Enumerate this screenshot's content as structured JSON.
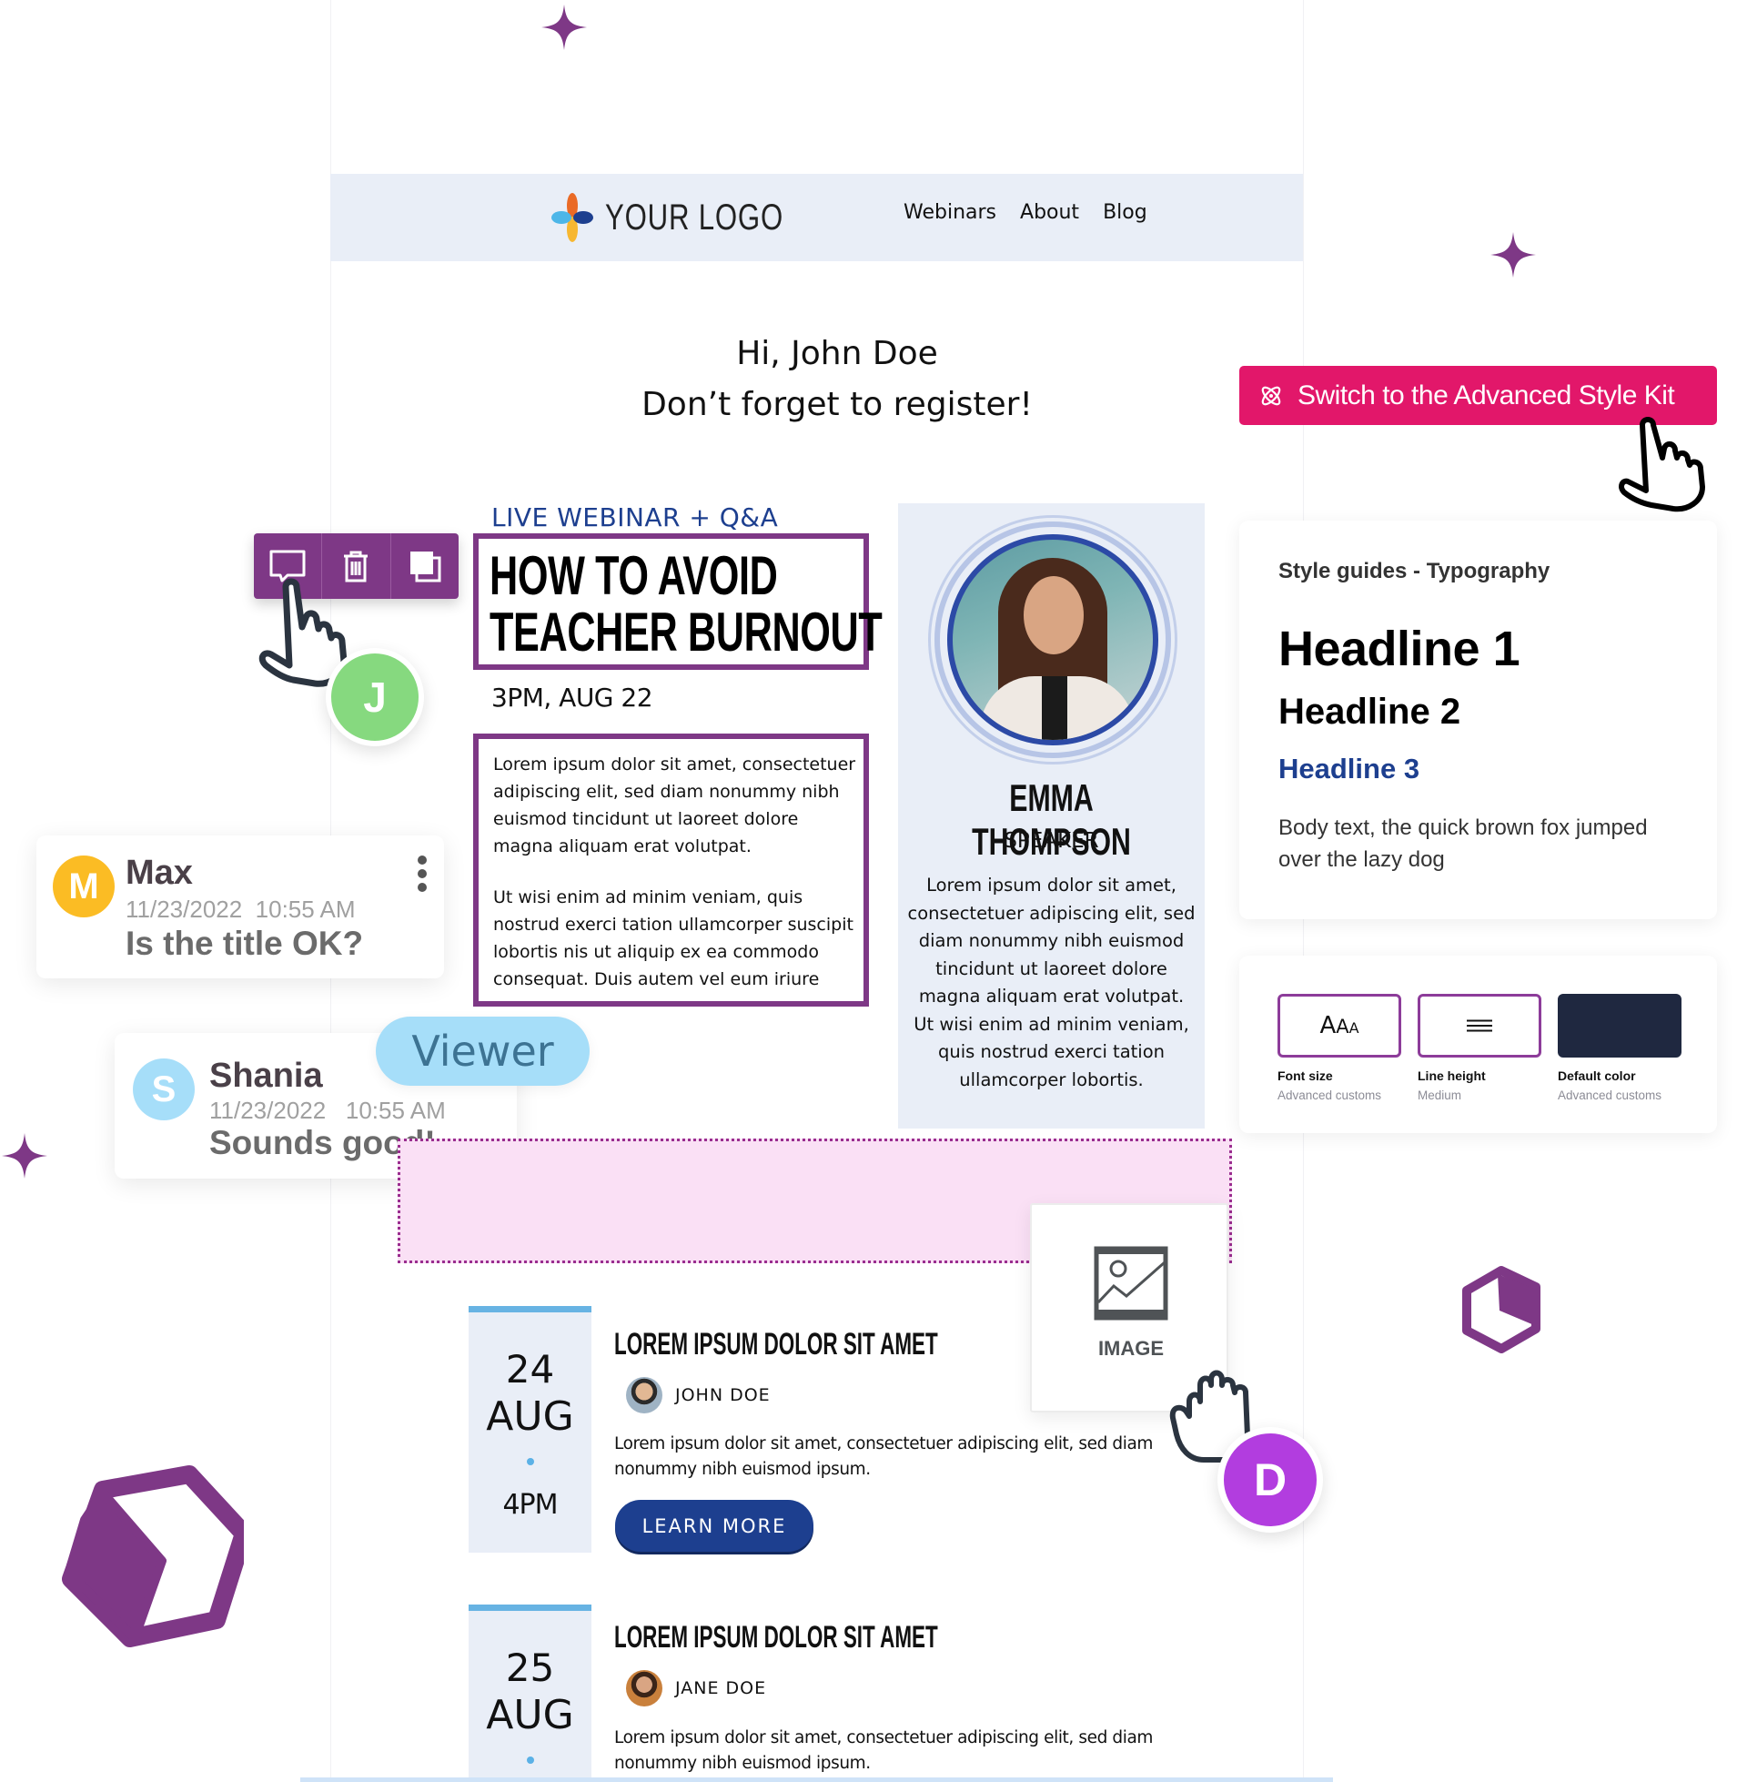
{
  "navbar": {
    "logo_text": "YOUR LOGO",
    "links": [
      "Webinars",
      "About",
      "Blog"
    ],
    "logo_colors": {
      "top": "#ea6a26",
      "left": "#4db6e8",
      "right": "#1d3f8f",
      "bottom": "#f7b731"
    }
  },
  "greeting": {
    "line1": "Hi, John Doe",
    "line2": "Don’t forget to register!"
  },
  "advanced_button": {
    "icon": "atom-icon",
    "label": "Switch to the Advanced Style Kit",
    "color": "#e2176a"
  },
  "toolbar": {
    "buttons": [
      {
        "name": "comment",
        "icon": "comment-icon"
      },
      {
        "name": "delete",
        "icon": "trash-icon"
      },
      {
        "name": "duplicate",
        "icon": "duplicate-icon"
      }
    ],
    "color": "#7e3886"
  },
  "webinar": {
    "label": "LIVE WEBINAR + Q&A",
    "title_line1": "HOW TO AVOID",
    "title_line2": "TEACHER BURNOUT",
    "datetime": "3PM, AUG 22",
    "body_p1": "Lorem ipsum dolor sit amet, consectetuer adipiscing elit, sed diam nonummy nibh euismod tincidunt ut laoreet dolore magna aliquam erat volutpat.",
    "body_p2": "Ut wisi enim ad minim veniam, quis nostrud exerci tation ullamcorper suscipit lobortis nis ut aliquip ex ea commodo consequat. Duis autem vel eum iriure"
  },
  "speaker": {
    "name": "EMMA THOMPSON",
    "role": "SPEAKER",
    "bio": "Lorem ipsum dolor sit amet, consectetuer adipiscing elit, sed diam nonummy nibh euismod tincidunt ut laoreet dolore magna aliquam erat volutpat. Ut wisi enim ad minim veniam, quis nostrud exerci tation ullamcorper lobortis."
  },
  "style_guide": {
    "title": "Style guides - Typography",
    "h1": "Headline 1",
    "h2": "Headline 2",
    "h3": "Headline 3",
    "body": "Body text, the quick brown fox jumped over the lazy dog",
    "h3_color": "#1d3f8f"
  },
  "properties": [
    {
      "label": "Font size",
      "sub": "Advanced customs",
      "glyph": "AAA"
    },
    {
      "label": "Line height",
      "sub": "Medium",
      "glyph": "≡"
    },
    {
      "label": "Default color",
      "sub": "Advanced customs",
      "color": "#1f2840"
    }
  ],
  "collaborators": {
    "j": {
      "initial": "J",
      "color": "#86d97f"
    },
    "d": {
      "initial": "D",
      "color": "#b23ddf"
    }
  },
  "comments": [
    {
      "initial": "M",
      "name": "Max",
      "date": "11/23/2022",
      "time": "10:55 AM",
      "message": "Is the title OK?",
      "avatar_color": "#fbbc24"
    },
    {
      "initial": "S",
      "name": "Shania",
      "date": "11/23/2022",
      "time": "10:55 AM",
      "message": "Sounds good!",
      "avatar_color": "#a6def9"
    }
  ],
  "viewer_badge": "Viewer",
  "image_block": {
    "label": "IMAGE"
  },
  "events": [
    {
      "day": "24",
      "month": "AUG",
      "time": "4PM",
      "title": "LOREM IPSUM DOLOR SIT AMET",
      "author": "JOHN DOE",
      "desc": "Lorem ipsum dolor sit amet, consectetuer adipiscing elit, sed diam nonummy nibh euismod ipsum.",
      "cta": "LEARN MORE"
    },
    {
      "day": "25",
      "month": "AUG",
      "title": "LOREM IPSUM DOLOR SIT AMET",
      "author": "JANE DOE",
      "desc": "Lorem ipsum dolor sit amet, consectetuer adipiscing elit, sed diam nonummy nibh euismod ipsum."
    }
  ],
  "accent_purple": "#7e3886"
}
